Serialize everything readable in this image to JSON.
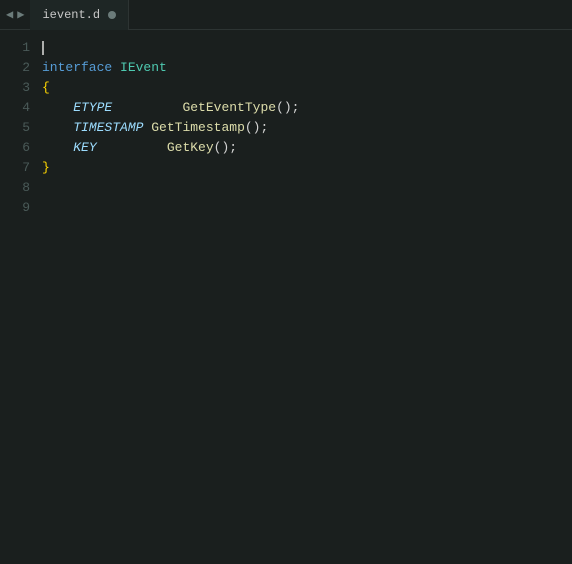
{
  "titleBar": {
    "navBack": "◀",
    "navForward": "▶",
    "tab": {
      "filename": "ievent.d",
      "dotLabel": ""
    }
  },
  "editor": {
    "lines": [
      {
        "number": "1",
        "content": []
      },
      {
        "number": "2",
        "content": [
          {
            "type": "kw-interface",
            "text": "interface"
          },
          {
            "type": "space",
            "text": " "
          },
          {
            "type": "kw-type",
            "text": "IEvent"
          }
        ]
      },
      {
        "number": "3",
        "content": [
          {
            "type": "brace",
            "text": "{"
          }
        ]
      },
      {
        "number": "4",
        "content": [
          {
            "type": "indent",
            "text": "    "
          },
          {
            "type": "kw-field",
            "text": "ETYPE"
          },
          {
            "type": "space",
            "text": "         "
          },
          {
            "type": "kw-method",
            "text": "GetEventType"
          },
          {
            "type": "punct",
            "text": "();"
          }
        ]
      },
      {
        "number": "5",
        "content": [
          {
            "type": "indent",
            "text": "    "
          },
          {
            "type": "kw-field",
            "text": "TIMESTAMP"
          },
          {
            "type": "space",
            "text": " "
          },
          {
            "type": "kw-method",
            "text": "GetTimestamp"
          },
          {
            "type": "punct",
            "text": "();"
          }
        ]
      },
      {
        "number": "6",
        "content": [
          {
            "type": "indent",
            "text": "    "
          },
          {
            "type": "kw-field",
            "text": "KEY"
          },
          {
            "type": "space",
            "text": "         "
          },
          {
            "type": "kw-method",
            "text": "GetKey"
          },
          {
            "type": "punct",
            "text": "();"
          }
        ]
      },
      {
        "number": "7",
        "content": [
          {
            "type": "brace",
            "text": "}"
          }
        ]
      },
      {
        "number": "8",
        "content": []
      },
      {
        "number": "9",
        "content": []
      }
    ]
  }
}
